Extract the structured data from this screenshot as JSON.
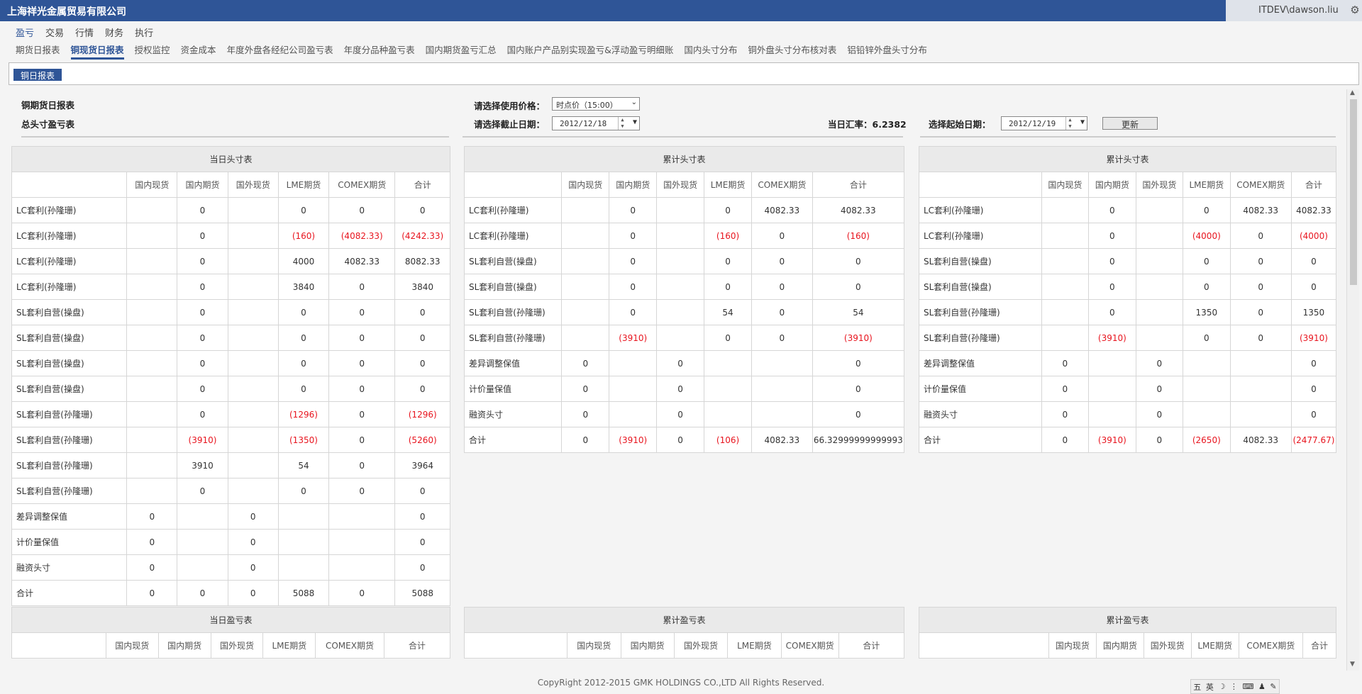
{
  "header": {
    "company": "上海祥光金属贸易有限公司",
    "user": "ITDEV\\dawson.liu"
  },
  "nav1": [
    "盈亏",
    "交易",
    "行情",
    "财务",
    "执行"
  ],
  "nav2": [
    "期货日报表",
    "铜现货日报表",
    "授权监控",
    "资金成本",
    "年度外盘各经纪公司盈亏表",
    "年度分品种盈亏表",
    "国内期货盈亏汇总",
    "国内账户产品别实现盈亏&浮动盈亏明细账",
    "国内头寸分布",
    "铜外盘头寸分布核对表",
    "铝铅锌外盘头寸分布"
  ],
  "tab": "铜日报表",
  "controls": {
    "title1": "铜期货日报表",
    "title2": "总头寸盈亏表",
    "price_label": "请选择使用价格：",
    "price_value": "时点价（15:00）",
    "end_label": "请选择截止日期：",
    "end_value": "2012/12/18",
    "rate": "当日汇率：6.2382",
    "start_label": "选择起始日期：",
    "start_value": "2012/12/19",
    "update": "更新"
  },
  "columns": [
    "",
    "国内现货",
    "国内期货",
    "国外现货",
    "LME期货",
    "COMEX期货",
    "合计"
  ],
  "daily": {
    "title": "当日头寸表",
    "rows": [
      [
        "LC套利(孙隆珊)",
        "",
        "0",
        "",
        "0",
        "0",
        "0"
      ],
      [
        "LC套利(孙隆珊)",
        "",
        "0",
        "",
        "(160)",
        "(4082.33)",
        "(4242.33)"
      ],
      [
        "LC套利(孙隆珊)",
        "",
        "0",
        "",
        "4000",
        "4082.33",
        "8082.33"
      ],
      [
        "LC套利(孙隆珊)",
        "",
        "0",
        "",
        "3840",
        "0",
        "3840"
      ],
      [
        "SL套利自营(操盘)",
        "",
        "0",
        "",
        "0",
        "0",
        "0"
      ],
      [
        "SL套利自营(操盘)",
        "",
        "0",
        "",
        "0",
        "0",
        "0"
      ],
      [
        "SL套利自营(操盘)",
        "",
        "0",
        "",
        "0",
        "0",
        "0"
      ],
      [
        "SL套利自营(操盘)",
        "",
        "0",
        "",
        "0",
        "0",
        "0"
      ],
      [
        "SL套利自营(孙隆珊)",
        "",
        "0",
        "",
        "(1296)",
        "0",
        "(1296)"
      ],
      [
        "SL套利自营(孙隆珊)",
        "",
        "(3910)",
        "",
        "(1350)",
        "0",
        "(5260)"
      ],
      [
        "SL套利自营(孙隆珊)",
        "",
        "3910",
        "",
        "54",
        "0",
        "3964"
      ],
      [
        "SL套利自营(孙隆珊)",
        "",
        "0",
        "",
        "0",
        "0",
        "0"
      ],
      [
        "差异调整保值",
        "0",
        "",
        "0",
        "",
        "",
        "0"
      ],
      [
        "计价量保值",
        "0",
        "",
        "0",
        "",
        "",
        "0"
      ],
      [
        "融资头寸",
        "0",
        "",
        "0",
        "",
        "",
        "0"
      ],
      [
        "合计",
        "0",
        "0",
        "0",
        "5088",
        "0",
        "5088"
      ]
    ]
  },
  "cum1": {
    "title": "累计头寸表",
    "rows": [
      [
        "LC套利(孙隆珊)",
        "",
        "0",
        "",
        "0",
        "4082.33",
        "4082.33"
      ],
      [
        "LC套利(孙隆珊)",
        "",
        "0",
        "",
        "(160)",
        "0",
        "(160)"
      ],
      [
        "SL套利自营(操盘)",
        "",
        "0",
        "",
        "0",
        "0",
        "0"
      ],
      [
        "SL套利自营(操盘)",
        "",
        "0",
        "",
        "0",
        "0",
        "0"
      ],
      [
        "SL套利自营(孙隆珊)",
        "",
        "0",
        "",
        "54",
        "0",
        "54"
      ],
      [
        "SL套利自营(孙隆珊)",
        "",
        "(3910)",
        "",
        "0",
        "0",
        "(3910)"
      ],
      [
        "差异调整保值",
        "0",
        "",
        "0",
        "",
        "",
        "0"
      ],
      [
        "计价量保值",
        "0",
        "",
        "0",
        "",
        "",
        "0"
      ],
      [
        "融资头寸",
        "0",
        "",
        "0",
        "",
        "",
        "0"
      ],
      [
        "合计",
        "0",
        "(3910)",
        "0",
        "(106)",
        "4082.33",
        "66.32999999999993"
      ]
    ]
  },
  "cum2": {
    "title": "累计头寸表",
    "rows": [
      [
        "LC套利(孙隆珊)",
        "",
        "0",
        "",
        "0",
        "4082.33",
        "4082.33"
      ],
      [
        "LC套利(孙隆珊)",
        "",
        "0",
        "",
        "(4000)",
        "0",
        "(4000)"
      ],
      [
        "SL套利自营(操盘)",
        "",
        "0",
        "",
        "0",
        "0",
        "0"
      ],
      [
        "SL套利自营(操盘)",
        "",
        "0",
        "",
        "0",
        "0",
        "0"
      ],
      [
        "SL套利自营(孙隆珊)",
        "",
        "0",
        "",
        "1350",
        "0",
        "1350"
      ],
      [
        "SL套利自营(孙隆珊)",
        "",
        "(3910)",
        "",
        "0",
        "0",
        "(3910)"
      ],
      [
        "差异调整保值",
        "0",
        "",
        "0",
        "",
        "",
        "0"
      ],
      [
        "计价量保值",
        "0",
        "",
        "0",
        "",
        "",
        "0"
      ],
      [
        "融资头寸",
        "0",
        "",
        "0",
        "",
        "",
        "0"
      ],
      [
        "合计",
        "0",
        "(3910)",
        "0",
        "(2650)",
        "4082.33",
        "(2477.67)"
      ]
    ]
  },
  "pl": [
    {
      "title": "当日盈亏表"
    },
    {
      "title": "累计盈亏表"
    },
    {
      "title": "累计盈亏表"
    }
  ],
  "footer": "CopyRight 2012-2015 GMK HOLDINGS CO.,LTD All Rights Reserved.",
  "tray": [
    "五",
    "英",
    "☽",
    "⋮",
    "⌨",
    "♟",
    "✎"
  ]
}
